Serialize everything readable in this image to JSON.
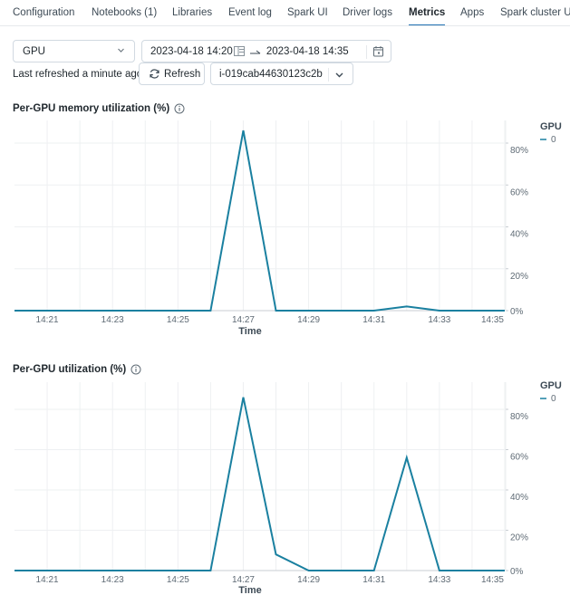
{
  "tabs": [
    {
      "label": "Configuration",
      "active": false
    },
    {
      "label": "Notebooks (1)",
      "active": false
    },
    {
      "label": "Libraries",
      "active": false
    },
    {
      "label": "Event log",
      "active": false
    },
    {
      "label": "Spark UI",
      "active": false
    },
    {
      "label": "Driver logs",
      "active": false
    },
    {
      "label": "Metrics",
      "active": true
    },
    {
      "label": "Apps",
      "active": false
    },
    {
      "label": "Spark cluster U",
      "active": false
    }
  ],
  "controls": {
    "metric_select": {
      "value": "GPU",
      "icon": "chevron-down-icon"
    },
    "date_range": {
      "start": "2023-04-18 14:20",
      "end": "2023-04-18 14:35",
      "arrow": "→",
      "icon": "calendar-icon"
    },
    "last_refreshed": "Last refreshed a minute ago",
    "refresh_label": "Refresh",
    "instance_select": {
      "value": "i-019cab44630123c2b",
      "icon": "chevron-down-icon"
    }
  },
  "colors": {
    "series": "#1a80a0",
    "grid": "#eef0f2",
    "baseline": "#c9ced3",
    "accent": "#2272b4"
  },
  "chart_data": [
    {
      "type": "line",
      "title": "Per-GPU memory utilization (%)",
      "xlabel": "Time",
      "ylabel": "",
      "x": [
        "14:20",
        "14:21",
        "14:22",
        "14:23",
        "14:24",
        "14:25",
        "14:26",
        "14:27",
        "14:28",
        "14:29",
        "14:30",
        "14:31",
        "14:32",
        "14:33",
        "14:34",
        "14:35"
      ],
      "x_ticks": [
        "14:21",
        "14:23",
        "14:25",
        "14:27",
        "14:29",
        "14:31",
        "14:33",
        "14:35"
      ],
      "y_ticks": [
        "0%",
        "20%",
        "40%",
        "60%",
        "80%"
      ],
      "ylim": [
        0,
        90
      ],
      "grid": true,
      "legend": {
        "title": "GPU",
        "placement": "top-right"
      },
      "series": [
        {
          "name": "0",
          "values": [
            0,
            0,
            0,
            0,
            0,
            0,
            0,
            86,
            0,
            0,
            0,
            0,
            2,
            0,
            0,
            0
          ]
        }
      ]
    },
    {
      "type": "line",
      "title": "Per-GPU utilization (%)",
      "xlabel": "Time",
      "ylabel": "",
      "x": [
        "14:20",
        "14:21",
        "14:22",
        "14:23",
        "14:24",
        "14:25",
        "14:26",
        "14:27",
        "14:28",
        "14:29",
        "14:30",
        "14:31",
        "14:32",
        "14:33",
        "14:34",
        "14:35"
      ],
      "x_ticks": [
        "14:21",
        "14:23",
        "14:25",
        "14:27",
        "14:29",
        "14:31",
        "14:33",
        "14:35"
      ],
      "y_ticks": [
        "0%",
        "20%",
        "40%",
        "60%",
        "80%"
      ],
      "ylim": [
        0,
        90
      ],
      "grid": true,
      "legend": {
        "title": "GPU",
        "placement": "top-right"
      },
      "series": [
        {
          "name": "0",
          "values": [
            0,
            0,
            0,
            0,
            0,
            0,
            0,
            86,
            8,
            0,
            0,
            0,
            56,
            0,
            0,
            0
          ]
        }
      ]
    }
  ]
}
